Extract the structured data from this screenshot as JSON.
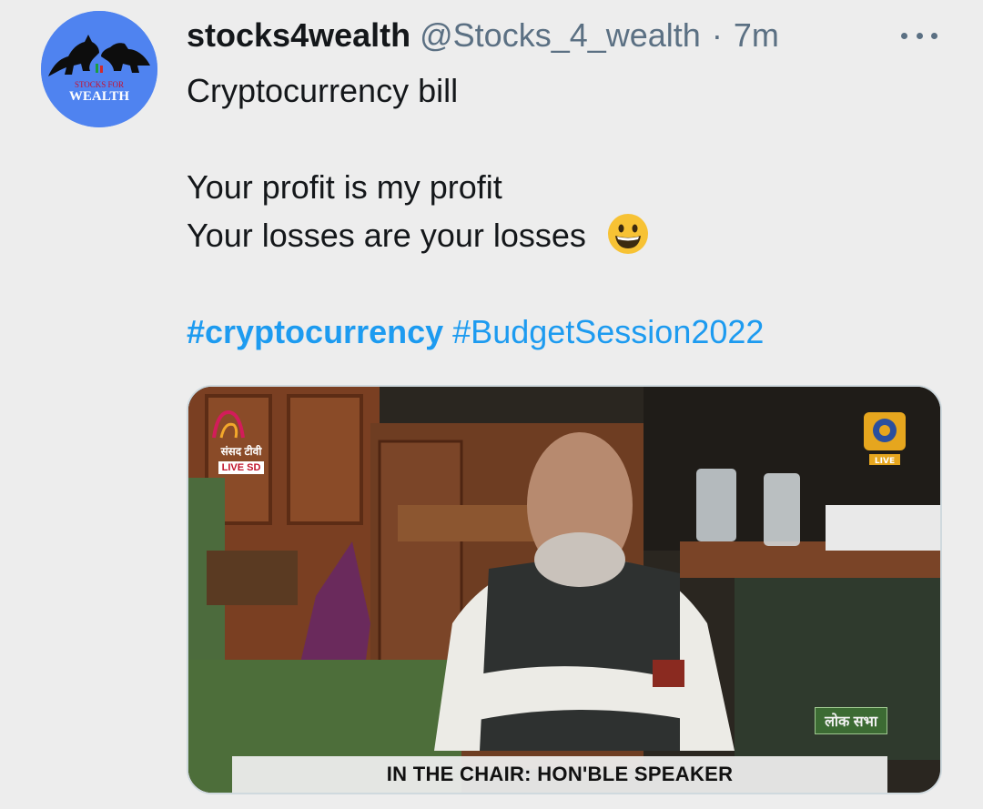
{
  "author": {
    "display_name": "stocks4wealth",
    "handle": "@Stocks_4_wealth",
    "separator": "·",
    "time": "7m",
    "avatar_text_top": "STOCKS FOR",
    "avatar_text_bottom": "WEALTH"
  },
  "tweet": {
    "lines": [
      "Cryptocurrency bill",
      "",
      "Your profit is my profit",
      "Your losses are your losses"
    ],
    "emoji": "grinning-face-emoji",
    "hashtags": [
      {
        "text": "#cryptocurrency",
        "bold": true
      },
      {
        "text": "#BudgetSession2022",
        "bold": false
      }
    ]
  },
  "media": {
    "channel_hindi": "संसद टीवी",
    "channel_live": "LIVE",
    "channel_quality": "SD",
    "dd_live": "LIVE",
    "lok_sabha": "लोक सभा",
    "caption": "IN THE CHAIR: HON'BLE SPEAKER"
  },
  "icons": {
    "more": "more-horizontal-icon"
  },
  "colors": {
    "background": "#ededed",
    "link": "#1d9bf0",
    "muted": "#5b7083",
    "avatar_bg": "#4f83f0"
  }
}
